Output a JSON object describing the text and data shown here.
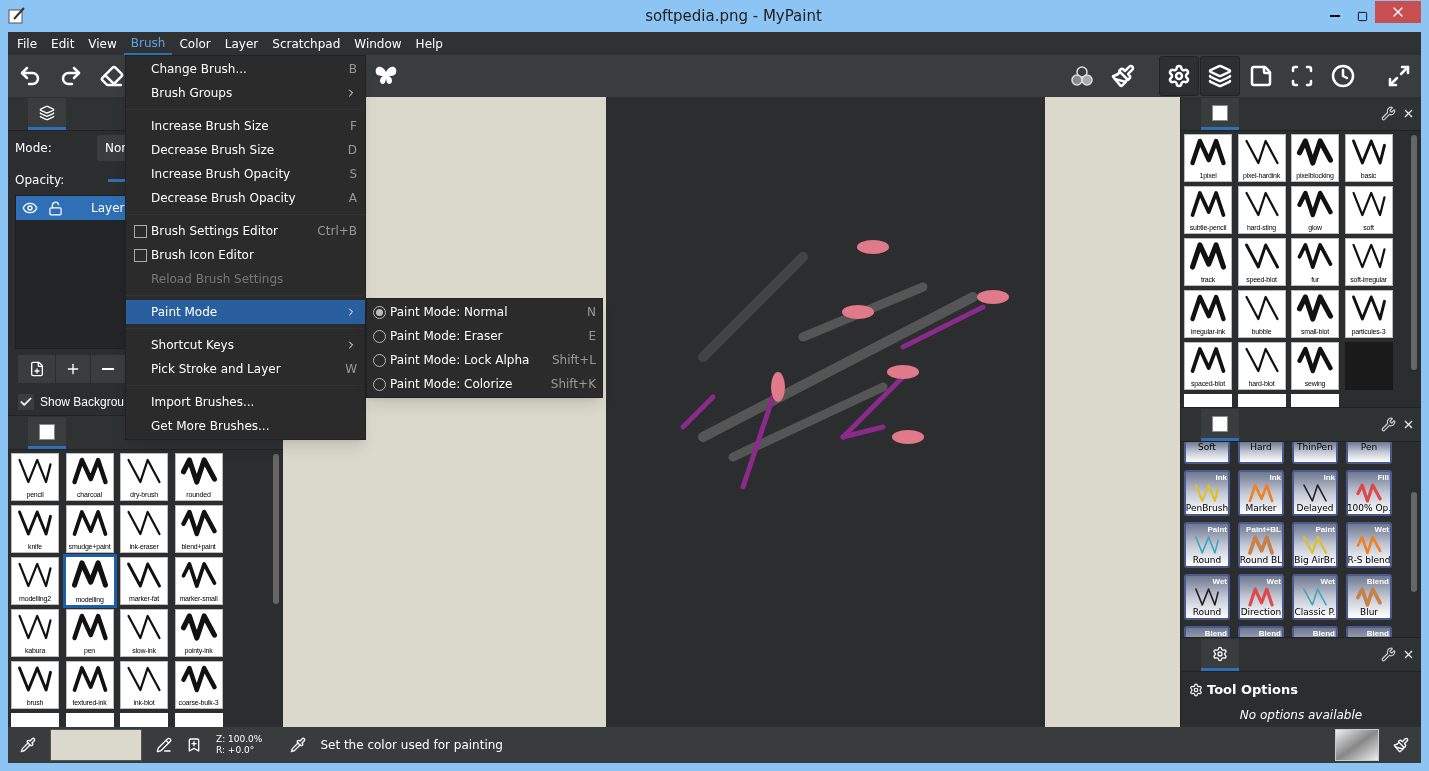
{
  "window": {
    "title": "softpedia.png - MyPaint"
  },
  "menubar": [
    {
      "label": "File",
      "selected": false
    },
    {
      "label": "Edit",
      "selected": false
    },
    {
      "label": "View",
      "selected": false
    },
    {
      "label": "Brush",
      "selected": true
    },
    {
      "label": "Color",
      "selected": false
    },
    {
      "label": "Layer",
      "selected": false
    },
    {
      "label": "Scratchpad",
      "selected": false
    },
    {
      "label": "Window",
      "selected": false
    },
    {
      "label": "Help",
      "selected": false
    }
  ],
  "brush_menu": [
    {
      "kind": "item",
      "label": "Change Brush...",
      "shortcut": "B",
      "disabled": false,
      "selected": false
    },
    {
      "kind": "submenu",
      "label": "Brush Groups",
      "disabled": false,
      "selected": false
    },
    {
      "kind": "separator"
    },
    {
      "kind": "item",
      "label": "Increase Brush Size",
      "shortcut": "F",
      "disabled": false,
      "selected": false
    },
    {
      "kind": "item",
      "label": "Decrease Brush Size",
      "shortcut": "D",
      "disabled": false,
      "selected": false
    },
    {
      "kind": "item",
      "label": "Increase Brush Opacity",
      "shortcut": "S",
      "disabled": false,
      "selected": false
    },
    {
      "kind": "item",
      "label": "Decrease Brush Opacity",
      "shortcut": "A",
      "disabled": false,
      "selected": false
    },
    {
      "kind": "separator"
    },
    {
      "kind": "check",
      "label": "Brush Settings Editor",
      "shortcut": "Ctrl+B",
      "checked": false,
      "disabled": false,
      "selected": false
    },
    {
      "kind": "check",
      "label": "Brush Icon Editor",
      "checked": false,
      "disabled": false,
      "selected": false
    },
    {
      "kind": "item",
      "label": "Reload Brush Settings",
      "disabled": true,
      "selected": false
    },
    {
      "kind": "separator"
    },
    {
      "kind": "submenu",
      "label": "Paint Mode",
      "disabled": false,
      "selected": true
    },
    {
      "kind": "separator"
    },
    {
      "kind": "submenu",
      "label": "Shortcut Keys",
      "disabled": false,
      "selected": false
    },
    {
      "kind": "item",
      "label": "Pick Stroke and Layer",
      "shortcut": "W",
      "disabled": false,
      "selected": false
    },
    {
      "kind": "separator"
    },
    {
      "kind": "item",
      "label": "Import Brushes...",
      "disabled": false,
      "selected": false
    },
    {
      "kind": "item",
      "label": "Get More Brushes...",
      "disabled": false,
      "selected": false
    }
  ],
  "paint_mode_menu": [
    {
      "label": "Paint Mode: Normal",
      "shortcut": "N",
      "checked": true
    },
    {
      "label": "Paint Mode: Eraser",
      "shortcut": "E",
      "checked": false
    },
    {
      "label": "Paint Mode: Lock Alpha",
      "shortcut": "Shift+L",
      "checked": false
    },
    {
      "label": "Paint Mode: Colorize",
      "shortcut": "Shift+K",
      "checked": false
    }
  ],
  "layers_panel": {
    "mode_label": "Mode:",
    "mode_value": "Nor",
    "opacity_label": "Opacity:",
    "opacity": {
      "level": 1
    },
    "layers": [
      {
        "name": "Layer",
        "selected": true
      }
    ],
    "show_background": {
      "label": "Show Backgrou",
      "checked": true
    }
  },
  "left_brushes": [
    {
      "label": "pencil",
      "selected": false
    },
    {
      "label": "charcoal",
      "selected": false
    },
    {
      "label": "dry-brush",
      "selected": false
    },
    {
      "label": "rounded",
      "selected": false
    },
    {
      "label": "knife",
      "selected": false
    },
    {
      "label": "smudge+paint",
      "selected": false
    },
    {
      "label": "ink-eraser",
      "selected": false
    },
    {
      "label": "blend+paint",
      "selected": false
    },
    {
      "label": "modelling2",
      "selected": false
    },
    {
      "label": "modelling",
      "selected": true
    },
    {
      "label": "marker-fat",
      "selected": false
    },
    {
      "label": "marker-small",
      "selected": false
    },
    {
      "label": "kabura",
      "selected": false
    },
    {
      "label": "pen",
      "selected": false
    },
    {
      "label": "slow-ink",
      "selected": false
    },
    {
      "label": "pointy-ink",
      "selected": false
    },
    {
      "label": "brush",
      "selected": false
    },
    {
      "label": "textured-ink",
      "selected": false
    },
    {
      "label": "ink-blot",
      "selected": false
    },
    {
      "label": "coarse-bulk-3",
      "selected": false
    }
  ],
  "right_brushes": [
    {
      "label": "1pixel"
    },
    {
      "label": "pixel-hardink"
    },
    {
      "label": "pixelblocking"
    },
    {
      "label": "basic"
    },
    {
      "label": "subtle-pencil"
    },
    {
      "label": "hard-sting"
    },
    {
      "label": "glow"
    },
    {
      "label": "soft"
    },
    {
      "label": "track"
    },
    {
      "label": "speed-blot"
    },
    {
      "label": "fur"
    },
    {
      "label": "soft-irregular"
    },
    {
      "label": "irregular-ink"
    },
    {
      "label": "bubble"
    },
    {
      "label": "small-blot"
    },
    {
      "label": "particules-3"
    },
    {
      "label": "spaced-blot"
    },
    {
      "label": "hard-blot"
    },
    {
      "label": "sewing"
    }
  ],
  "deevad_brushes": [
    {
      "label": "Soft"
    },
    {
      "label": "Hard"
    },
    {
      "label": "ThinPen"
    },
    {
      "label": "Pen"
    },
    {
      "tag": "Ink",
      "label": "PenBrush"
    },
    {
      "tag": "Ink",
      "label": "Marker"
    },
    {
      "tag": "Ink",
      "label": "Delayed"
    },
    {
      "tag": "Fill",
      "label": "100% Op."
    },
    {
      "tag": "Paint",
      "label": "Round"
    },
    {
      "tag": "Paint+BL",
      "label": "Round BL"
    },
    {
      "tag": "Paint",
      "label": "Big AirBr."
    },
    {
      "tag": "Wet",
      "label": "R-S blend"
    },
    {
      "tag": "Wet",
      "label": "Round"
    },
    {
      "tag": "Wet",
      "label": "Direction"
    },
    {
      "tag": "Wet",
      "label": "Classic P."
    },
    {
      "tag": "Blend",
      "label": "Blur"
    },
    {
      "tag": "Blend"
    },
    {
      "tag": "Blend"
    },
    {
      "tag": "Blend"
    },
    {
      "tag": "Blend"
    }
  ],
  "tool_options": {
    "title": "Tool Options",
    "message": "No options available"
  },
  "status_bar": {
    "zoom": "Z: 100.0%",
    "rotation": "R: +0.0°",
    "message": "Set the color used for painting"
  }
}
